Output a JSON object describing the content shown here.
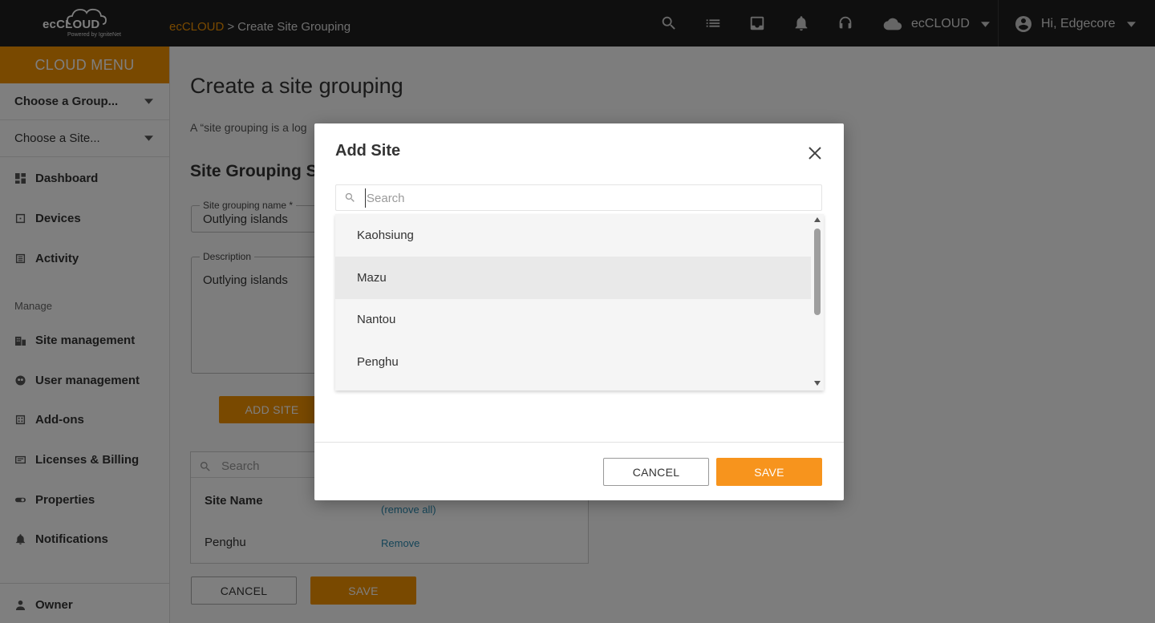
{
  "topbar": {
    "logo_text": "ecCLOUD",
    "logo_powered": "Powered by IgniteNet",
    "breadcrumb_root": "ecCLOUD",
    "breadcrumb_separator": ">",
    "breadcrumb_current": "Create Site Grouping",
    "account_label": "ecCLOUD",
    "user_greeting": "Hi, Edgecore"
  },
  "sidebar": {
    "menu_title": "CLOUD MENU",
    "group_chooser": "Choose a Group...",
    "site_chooser": "Choose a Site...",
    "items": [
      {
        "label": "Dashboard",
        "icon": "dashboard-icon"
      },
      {
        "label": "Devices",
        "icon": "devices-icon"
      },
      {
        "label": "Activity",
        "icon": "activity-icon"
      }
    ],
    "manage_label": "Manage",
    "manage_items": [
      {
        "label": "Site management",
        "icon": "building-icon"
      },
      {
        "label": "User management",
        "icon": "user-management-icon"
      },
      {
        "label": "Add-ons",
        "icon": "addons-icon"
      },
      {
        "label": "Licenses & Billing",
        "icon": "billing-icon"
      },
      {
        "label": "Properties",
        "icon": "properties-icon"
      },
      {
        "label": "Notifications",
        "icon": "bell-icon"
      }
    ],
    "owner_label": "Owner"
  },
  "main": {
    "page_title": "Create a site grouping",
    "intro_text": "A “site grouping is a log",
    "section_title": "Site Grouping Se",
    "name_field": {
      "label": "Site grouping name *",
      "value": "Outlying islands"
    },
    "description_field": {
      "label": "Description",
      "value": "Outlying islands"
    },
    "add_site_label": "ADD SITE",
    "table": {
      "search_placeholder": "Search",
      "column_site_name": "Site Name",
      "remove_all_label": "(remove all)",
      "rows": [
        {
          "site": "Penghu",
          "action": "Remove"
        }
      ]
    },
    "cancel_label": "CANCEL",
    "save_label": "SAVE"
  },
  "modal": {
    "title": "Add Site",
    "search_placeholder": "Search",
    "sites": [
      "Kaohsiung",
      "Mazu",
      "Nantou",
      "Penghu"
    ],
    "hovered_site": "Mazu",
    "cancel_label": "CANCEL",
    "save_label": "SAVE"
  },
  "colors": {
    "accent": "#f39200",
    "topbar": "#1f1f1f",
    "link": "#2a8ab0"
  }
}
